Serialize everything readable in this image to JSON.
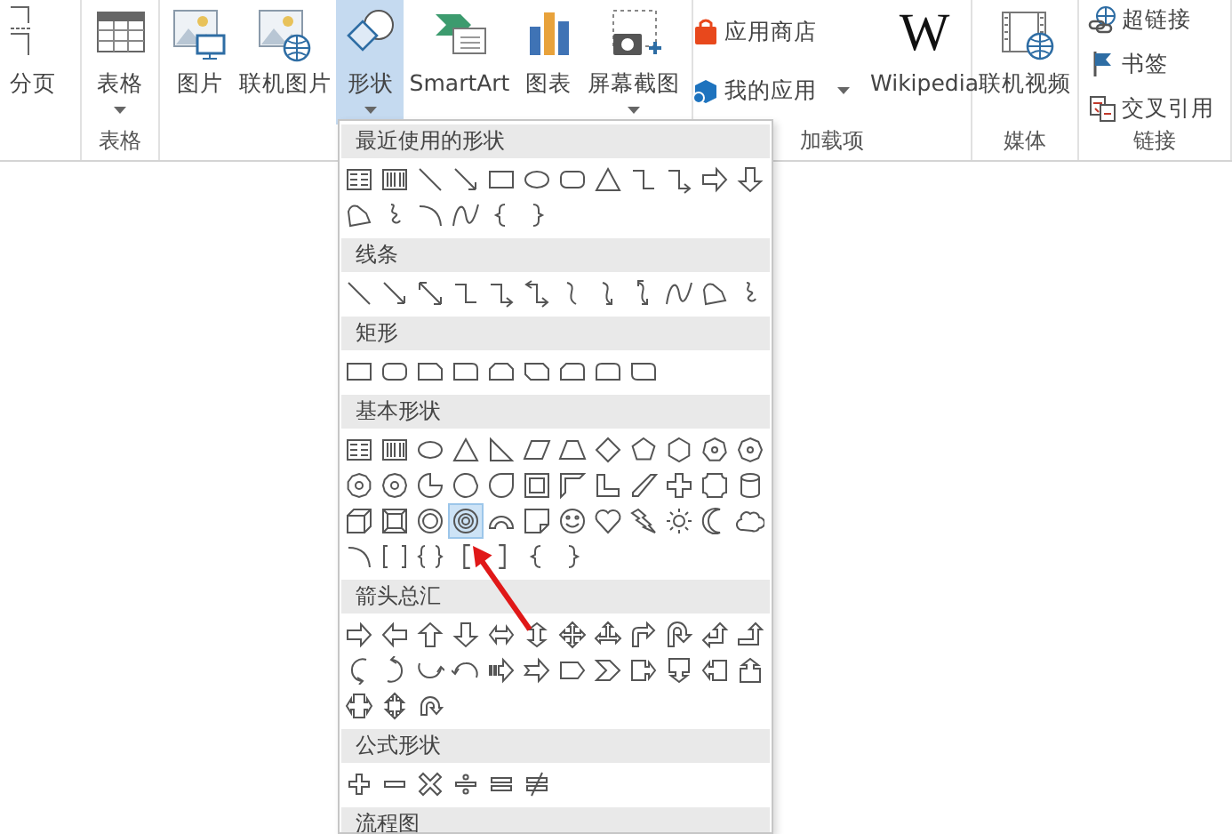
{
  "ribbon": {
    "groups": [
      {
        "buttons": [
          {
            "label": "分页",
            "selected": false,
            "dropdown": false
          }
        ]
      },
      {
        "label": "表格",
        "buttons": [
          {
            "label": "表格",
            "selected": false,
            "dropdown": true
          }
        ]
      },
      {
        "buttons": [
          {
            "label": "图片",
            "selected": false,
            "dropdown": false
          },
          {
            "label": "联机图片",
            "selected": false,
            "dropdown": false
          },
          {
            "label": "形状",
            "selected": true,
            "dropdown": true
          },
          {
            "label": "SmartArt",
            "selected": false,
            "dropdown": false
          },
          {
            "label": "图表",
            "selected": false,
            "dropdown": false
          },
          {
            "label": "屏幕截图",
            "selected": false,
            "dropdown": true
          }
        ]
      },
      {
        "label": "加载项",
        "small_buttons": [
          {
            "label": "应用商店",
            "dropdown": false
          },
          {
            "label": "我的应用",
            "dropdown": true
          }
        ],
        "buttons": [
          {
            "label": "Wikipedia",
            "logo": "W",
            "selected": false,
            "dropdown": false
          }
        ]
      },
      {
        "label": "媒体",
        "buttons": [
          {
            "label": "联机视频",
            "selected": false,
            "dropdown": false
          }
        ]
      },
      {
        "label": "链接",
        "small_buttons": [
          {
            "label": "超链接",
            "dropdown": false
          },
          {
            "label": "书签",
            "dropdown": false
          },
          {
            "label": "交叉引用",
            "dropdown": false
          }
        ]
      }
    ]
  },
  "shapes_menu": {
    "sections": [
      {
        "title": "最近使用的形状",
        "shapes": [
          {
            "selected": false
          },
          {
            "selected": false
          },
          {
            "selected": false
          },
          {
            "selected": false
          },
          {
            "selected": false
          },
          {
            "selected": false
          },
          {
            "selected": false
          },
          {
            "selected": false
          },
          {
            "selected": false
          },
          {
            "selected": false
          },
          {
            "selected": false
          },
          {
            "selected": false
          },
          {
            "selected": false
          },
          {
            "selected": false
          },
          {
            "selected": false
          },
          {
            "selected": false
          },
          {
            "selected": false
          },
          {
            "selected": false
          }
        ]
      },
      {
        "title": "线条",
        "shapes": [
          {
            "selected": false
          },
          {
            "selected": false
          },
          {
            "selected": false
          },
          {
            "selected": false
          },
          {
            "selected": false
          },
          {
            "selected": false
          },
          {
            "selected": false
          },
          {
            "selected": false
          },
          {
            "selected": false
          },
          {
            "selected": false
          },
          {
            "selected": false
          },
          {
            "selected": false
          }
        ]
      },
      {
        "title": "矩形",
        "shapes": [
          {
            "selected": false
          },
          {
            "selected": false
          },
          {
            "selected": false
          },
          {
            "selected": false
          },
          {
            "selected": false
          },
          {
            "selected": false
          },
          {
            "selected": false
          },
          {
            "selected": false
          },
          {
            "selected": false
          }
        ]
      },
      {
        "title": "基本形状",
        "shapes": [
          {
            "selected": false
          },
          {
            "selected": false
          },
          {
            "selected": false
          },
          {
            "selected": false
          },
          {
            "selected": false
          },
          {
            "selected": false
          },
          {
            "selected": false
          },
          {
            "selected": false
          },
          {
            "selected": false
          },
          {
            "selected": false
          },
          {
            "selected": false
          },
          {
            "selected": false
          },
          {
            "selected": false
          },
          {
            "selected": false
          },
          {
            "selected": false
          },
          {
            "selected": false
          },
          {
            "selected": false
          },
          {
            "selected": false
          },
          {
            "selected": false
          },
          {
            "selected": false
          },
          {
            "selected": false
          },
          {
            "selected": false
          },
          {
            "selected": false
          },
          {
            "selected": false
          },
          {
            "selected": false
          },
          {
            "selected": false
          },
          {
            "selected": false
          },
          {
            "selected": true
          },
          {
            "selected": false
          },
          {
            "selected": false
          },
          {
            "selected": false
          },
          {
            "selected": false
          },
          {
            "selected": false
          },
          {
            "selected": false
          },
          {
            "selected": false
          },
          {
            "selected": false
          },
          {
            "selected": false
          },
          {
            "selected": false
          },
          {
            "selected": false
          },
          {
            "selected": false
          },
          {
            "selected": false
          },
          {
            "selected": false
          },
          {
            "selected": false
          }
        ]
      },
      {
        "title": "箭头总汇",
        "shapes": [
          {
            "selected": false
          },
          {
            "selected": false
          },
          {
            "selected": false
          },
          {
            "selected": false
          },
          {
            "selected": false
          },
          {
            "selected": false
          },
          {
            "selected": false
          },
          {
            "selected": false
          },
          {
            "selected": false
          },
          {
            "selected": false
          },
          {
            "selected": false
          },
          {
            "selected": false
          },
          {
            "selected": false
          },
          {
            "selected": false
          },
          {
            "selected": false
          },
          {
            "selected": false
          },
          {
            "selected": false
          },
          {
            "selected": false
          },
          {
            "selected": false
          },
          {
            "selected": false
          },
          {
            "selected": false
          },
          {
            "selected": false
          },
          {
            "selected": false
          },
          {
            "selected": false
          },
          {
            "selected": false
          },
          {
            "selected": false
          },
          {
            "selected": false
          }
        ]
      },
      {
        "title": "公式形状",
        "shapes": [
          {
            "selected": false
          },
          {
            "selected": false
          },
          {
            "selected": false
          },
          {
            "selected": false
          },
          {
            "selected": false
          },
          {
            "selected": false
          }
        ]
      },
      {
        "title": "流程图"
      }
    ]
  }
}
